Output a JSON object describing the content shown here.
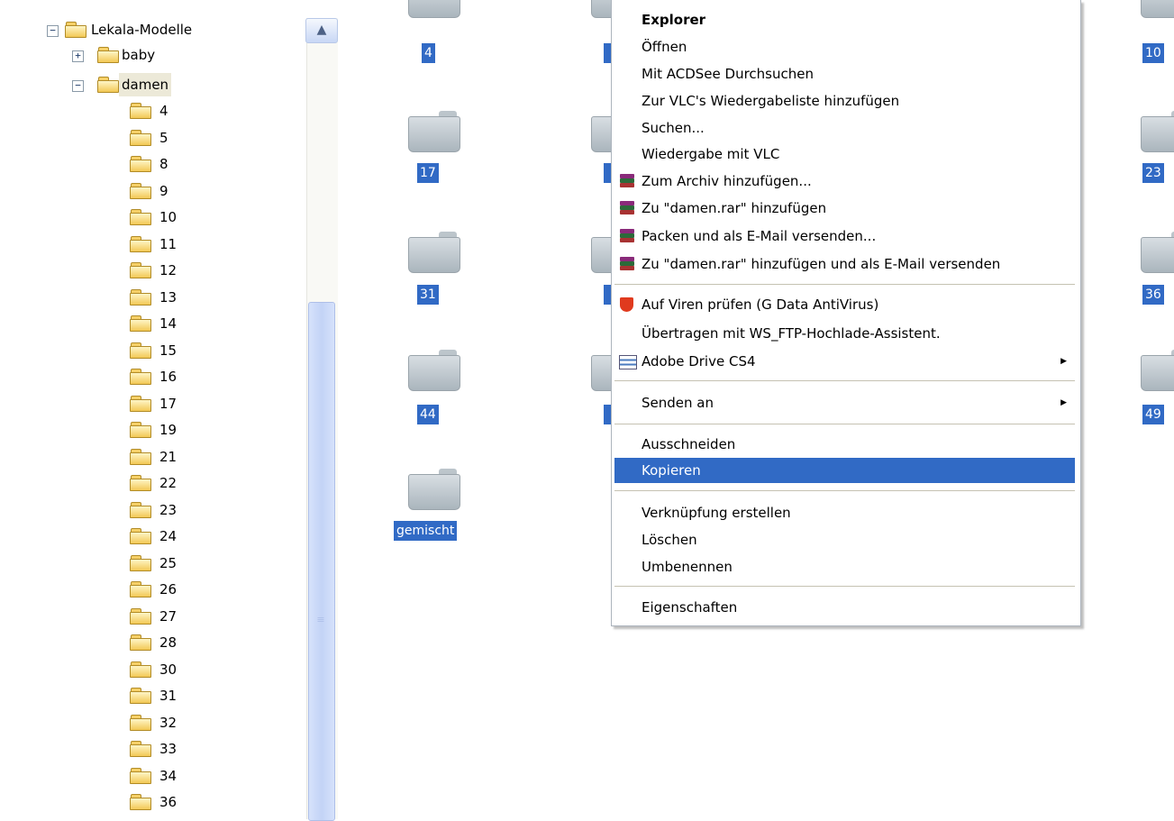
{
  "tree": {
    "root_label": "Lekala-Modelle",
    "children": [
      {
        "label": "baby",
        "expander": "+"
      },
      {
        "label": "damen",
        "expander": "−"
      }
    ],
    "root_expander": "−",
    "damen_children": [
      "4",
      "5",
      "8",
      "9",
      "10",
      "11",
      "12",
      "13",
      "14",
      "15",
      "16",
      "17",
      "19",
      "21",
      "22",
      "23",
      "24",
      "25",
      "26",
      "27",
      "28",
      "30",
      "31",
      "32",
      "33",
      "34",
      "36"
    ]
  },
  "content": {
    "folders": [
      "4",
      "17",
      "31",
      "44",
      "gemischt",
      "10",
      "23",
      "36",
      "49"
    ]
  },
  "context_menu": {
    "items": {
      "explorer": "Explorer",
      "open": "Öffnen",
      "acdsee": "Mit ACDSee Durchsuchen",
      "vlc_playlist": "Zur VLC's Wiedergabeliste hinzufügen",
      "search": "Suchen...",
      "vlc_play": "Wiedergabe mit VLC",
      "add_archive": "Zum Archiv hinzufügen...",
      "add_rar": "Zu \"damen.rar\" hinzufügen",
      "pack_email": "Packen und als E-Mail versenden...",
      "rar_email": "Zu \"damen.rar\" hinzufügen und als E-Mail versenden",
      "virus_scan": "Auf Viren prüfen (G Data AntiVirus)",
      "ftp": "Übertragen mit WS_FTP-Hochlade-Assistent.",
      "adobe_drive": "Adobe Drive CS4",
      "send_to": "Senden an",
      "cut": "Ausschneiden",
      "copy": "Kopieren",
      "shortcut": "Verknüpfung erstellen",
      "delete": "Löschen",
      "rename": "Umbenennen",
      "properties": "Eigenschaften"
    },
    "highlighted": "copy",
    "highlight_color": "#316ac5"
  },
  "icons": {
    "scroll_up": "▲",
    "submenu_arrow": "▶"
  }
}
